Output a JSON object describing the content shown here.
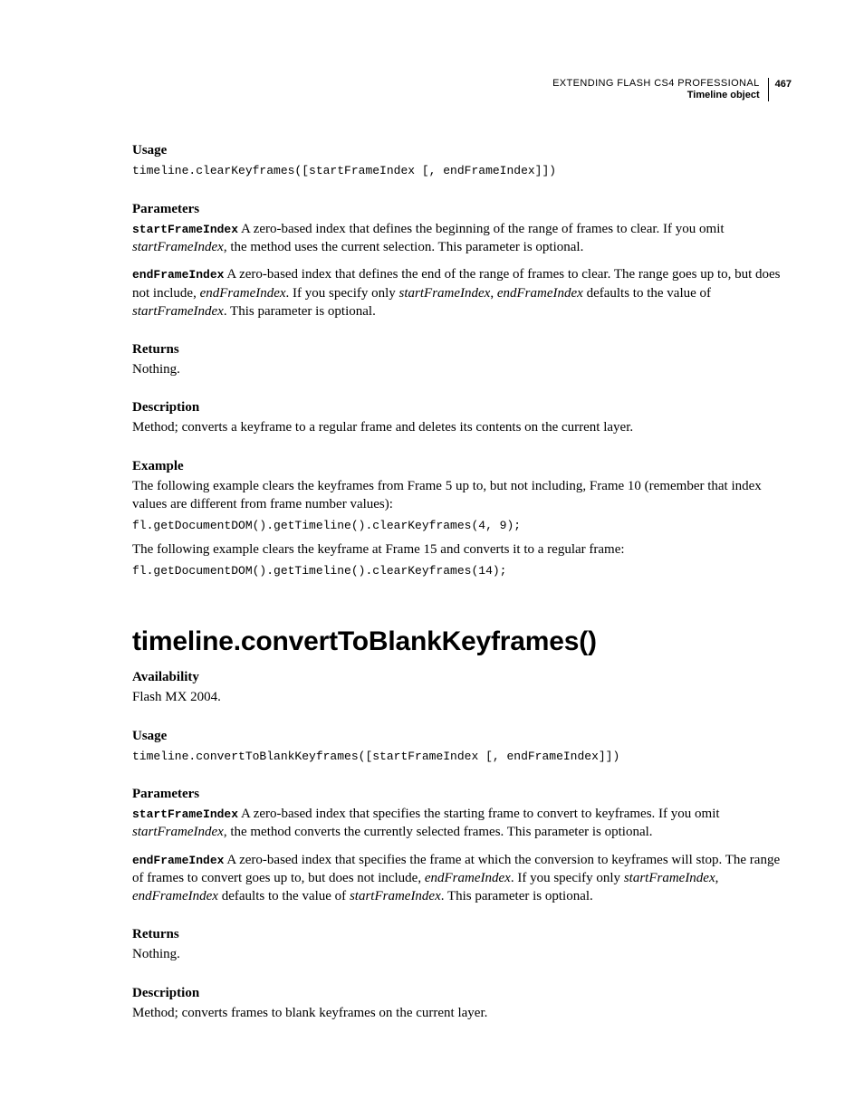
{
  "header": {
    "title": "EXTENDING FLASH CS4 PROFESSIONAL",
    "section": "Timeline object",
    "page": "467"
  },
  "s1": {
    "usage_h": "Usage",
    "usage_code": "timeline.clearKeyframes([startFrameIndex [, endFrameIndex]])",
    "params_h": "Parameters",
    "p1_code": "startFrameIndex",
    "p1_a": "  A zero-based index that defines the beginning of the range of frames to clear. If you omit ",
    "p1_b": "startFrameIndex",
    "p1_c": ", the method uses the current selection. This parameter is optional.",
    "p2_code": "endFrameIndex",
    "p2_a": "  A zero-based index that defines the end of the range of frames to clear. The range goes up to, but does not include, ",
    "p2_b": "endFrameIndex",
    "p2_c": ". If you specify only ",
    "p2_d": "startFrameIndex",
    "p2_e": ", ",
    "p2_f": "endFrameIndex",
    "p2_g": " defaults to the value of ",
    "p2_h": "startFrameIndex",
    "p2_i": ". This parameter is optional.",
    "returns_h": "Returns",
    "returns_body": "Nothing.",
    "desc_h": "Description",
    "desc_body": "Method; converts a keyframe to a regular frame and deletes its contents on the current layer.",
    "example_h": "Example",
    "ex1": "The following example clears the keyframes from Frame 5 up to, but not including, Frame 10 (remember that index values are different from frame number values):",
    "ex1_code": "fl.getDocumentDOM().getTimeline().clearKeyframes(4, 9);",
    "ex2": "The following example clears the keyframe at Frame 15 and converts it to a regular frame:",
    "ex2_code": "fl.getDocumentDOM().getTimeline().clearKeyframes(14);"
  },
  "s2": {
    "title": "timeline.convertToBlankKeyframes()",
    "avail_h": "Availability",
    "avail_body": "Flash MX 2004.",
    "usage_h": "Usage",
    "usage_code": "timeline.convertToBlankKeyframes([startFrameIndex [, endFrameIndex]])",
    "params_h": "Parameters",
    "p1_code": "startFrameIndex",
    "p1_a": "  A zero-based index that specifies the starting frame to convert to keyframes. If you omit ",
    "p1_b": "startFrameIndex",
    "p1_c": ", the method converts the currently selected frames. This parameter is optional.",
    "p2_code": "endFrameIndex",
    "p2_a": "  A zero-based index that specifies the frame at which the conversion to keyframes will stop. The range of frames to convert goes up to, but does not include, ",
    "p2_b": "endFrameIndex",
    "p2_c": ". If you specify only ",
    "p2_d": "startFrameIndex",
    "p2_e": ", ",
    "p2_f": "endFrameIndex",
    "p2_g": " defaults to the value of ",
    "p2_h": "startFrameIndex",
    "p2_i": ". This parameter is optional.",
    "returns_h": "Returns",
    "returns_body": "Nothing.",
    "desc_h": "Description",
    "desc_body": "Method; converts frames to blank keyframes on the current layer."
  }
}
